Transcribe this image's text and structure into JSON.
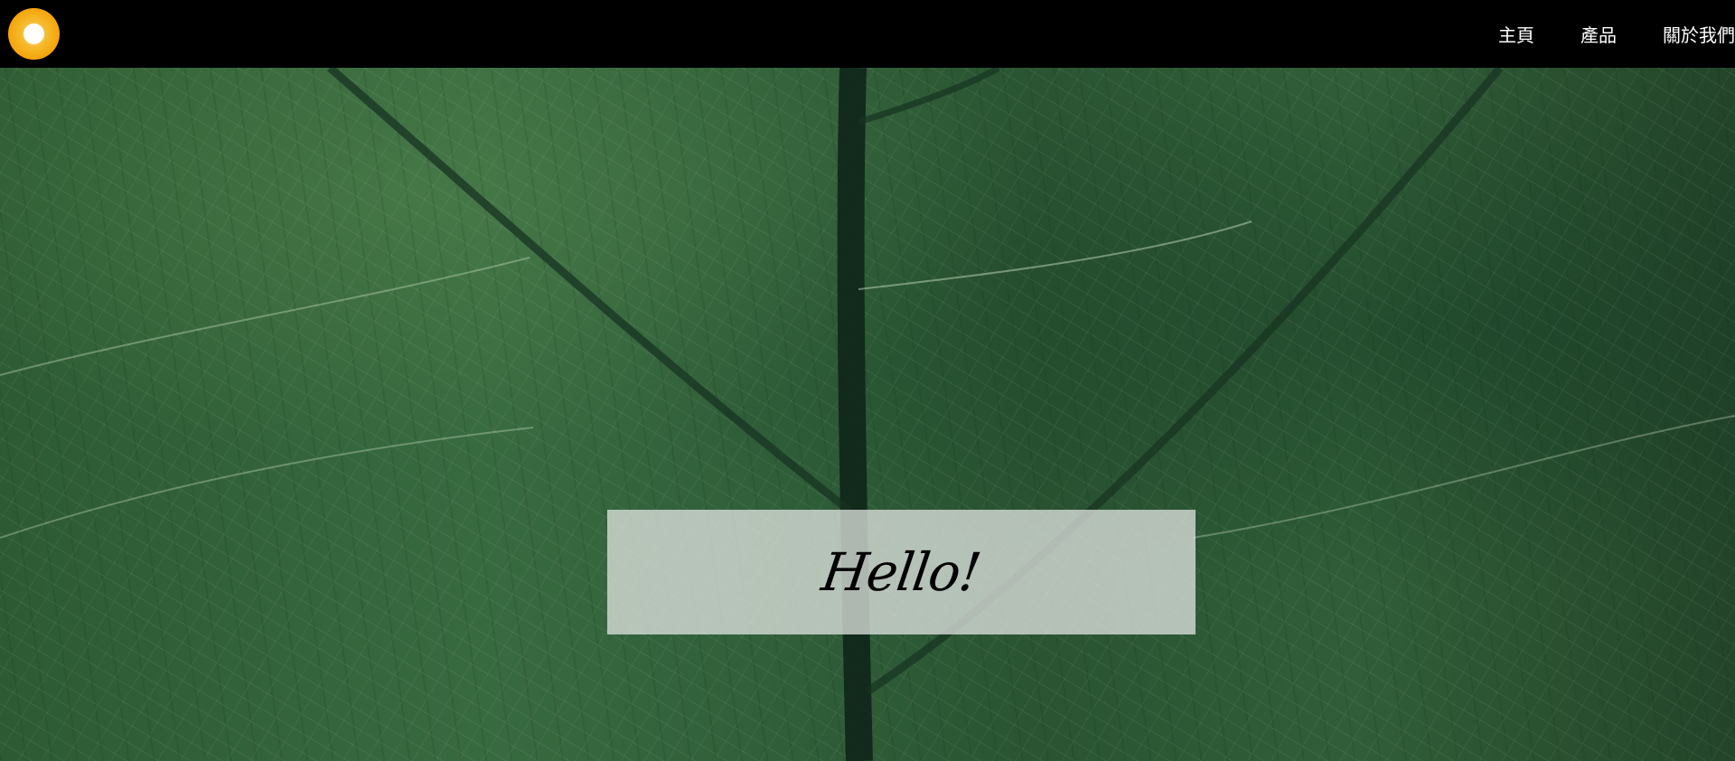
{
  "header": {
    "logo_icon": "orange-ring-logo",
    "nav_items": [
      "主頁",
      "產品",
      "關於我們"
    ]
  },
  "hero": {
    "background_icon": "green-leaf-texture",
    "message": "Hello!"
  },
  "colors": {
    "navbar_background": "#000000",
    "logo_primary": "#F4A409",
    "panel_background": "#E1E4E1",
    "text_primary": "#000000"
  }
}
